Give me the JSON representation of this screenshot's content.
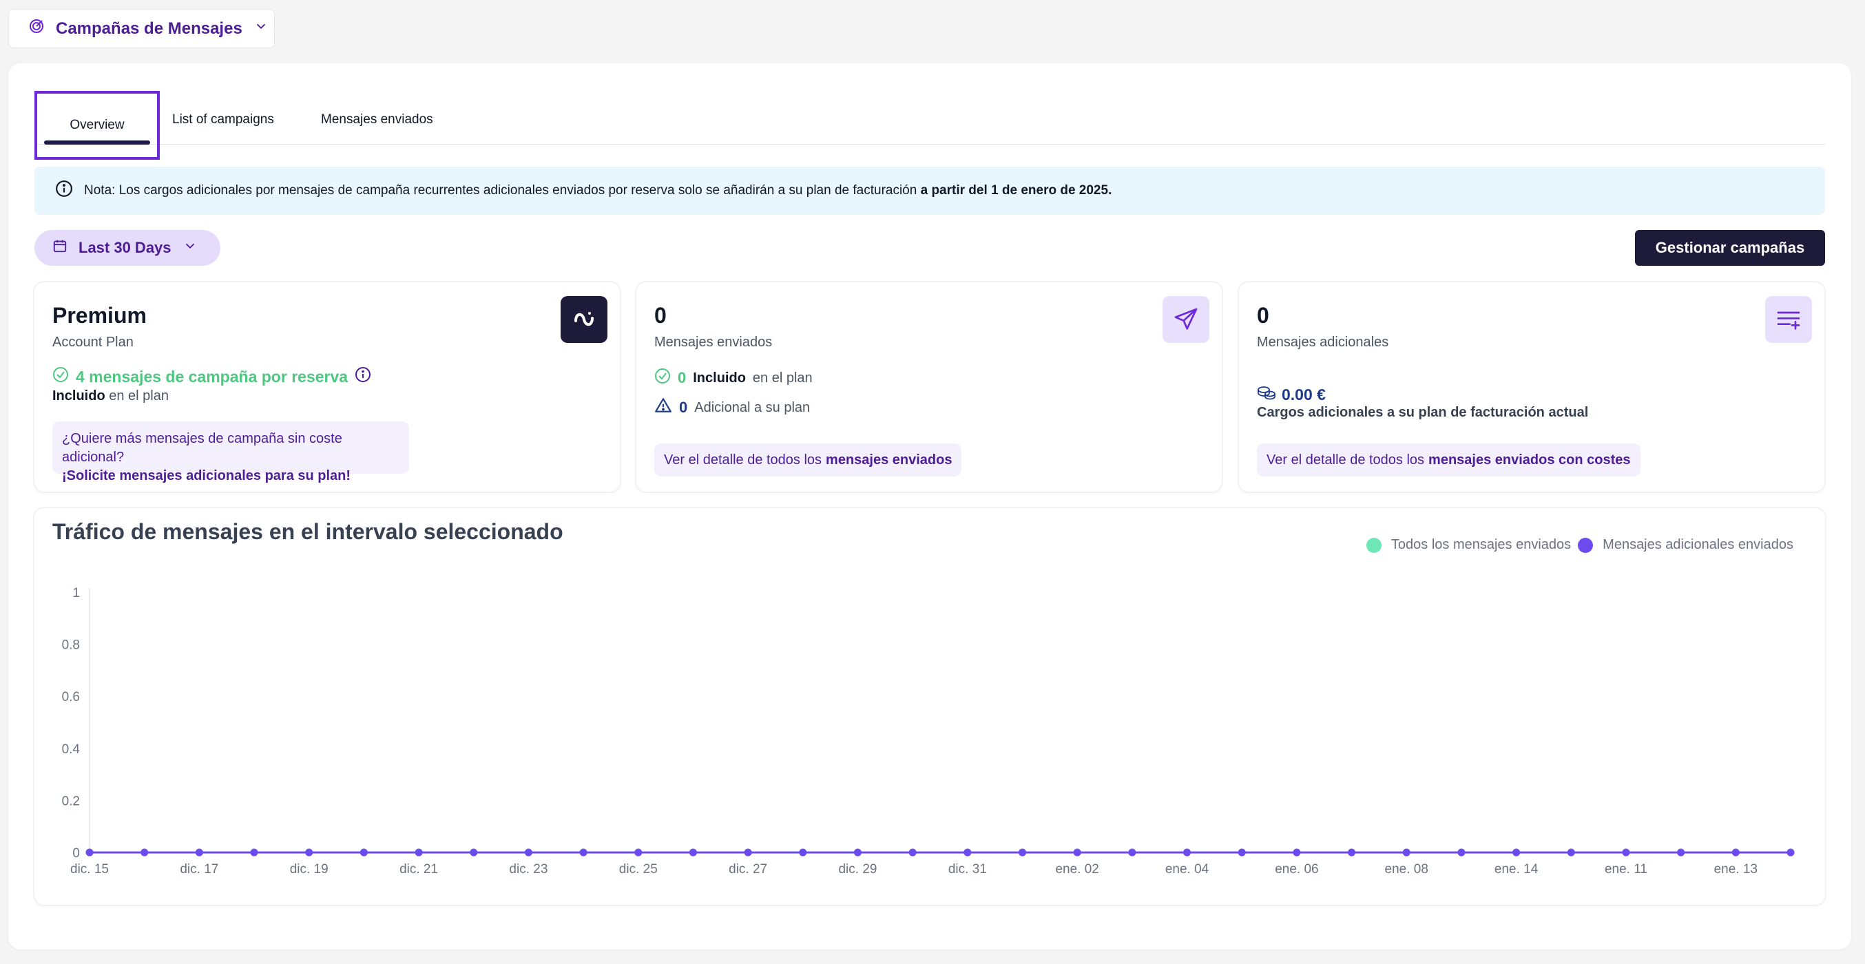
{
  "top_selector": {
    "label": "Campañas de Mensajes"
  },
  "tabs": [
    {
      "label": "Overview",
      "active": true
    },
    {
      "label": "List of campaigns",
      "active": false
    },
    {
      "label": "Mensajes enviados",
      "active": false
    }
  ],
  "note": {
    "text": "Nota: Los cargos adicionales por mensajes de campaña recurrentes adicionales enviados por reserva solo se añadirán a su plan de facturación ",
    "bold": "a partir del 1 de enero de 2025."
  },
  "date_filter": {
    "label": "Last 30 Days"
  },
  "manage_button": {
    "label": "Gestionar campañas"
  },
  "cards": {
    "plan": {
      "title": "Premium",
      "subtitle": "Account Plan",
      "campaign_msgs": "4 mensajes de campaña por reserva",
      "included_bold": "Incluido",
      "included_rest": " en el plan",
      "promo_line1": "¿Quiere más mensajes de campaña sin coste adicional?",
      "promo_line2": "¡Solicite mensajes adicionales para su plan!"
    },
    "sent": {
      "count": "0",
      "subtitle": "Mensajes enviados",
      "included_num": "0",
      "included_bold": "Incluido",
      "included_rest": "en el plan",
      "additional_num": "0",
      "additional_rest": "Adicional a su plan",
      "link_prefix": "Ver el detalle de todos los",
      "link_bold": "mensajes enviados"
    },
    "additional": {
      "count": "0",
      "subtitle": "Mensajes adicionales",
      "amount": "0.00 €",
      "charges": "Cargos adicionales a su plan de facturación actual",
      "link_prefix": "Ver el detalle de todos los",
      "link_bold": "mensajes enviados con costes"
    }
  },
  "chart": {
    "title": "Tráfico de mensajes en el intervalo seleccionado",
    "legend": [
      {
        "label": "Todos los mensajes enviados",
        "color": "#6ee7b7"
      },
      {
        "label": "Mensajes adicionales enviados",
        "color": "#6d4aed"
      }
    ]
  },
  "chart_data": {
    "type": "line",
    "title": "Tráfico de mensajes en el intervalo seleccionado",
    "xlabel": "",
    "ylabel": "",
    "ylim": [
      0,
      1
    ],
    "y_ticks": [
      "0",
      "0.2",
      "0.4",
      "0.6",
      "0.8",
      "1"
    ],
    "x_tick_labels": [
      "dic. 15",
      "dic. 17",
      "dic. 19",
      "dic. 21",
      "dic. 23",
      "dic. 25",
      "dic. 27",
      "dic. 29",
      "dic. 31",
      "ene. 02",
      "ene. 04",
      "ene. 06",
      "ene. 08",
      "ene. 14",
      "ene. 11",
      "ene. 13"
    ],
    "point_count": 32,
    "series": [
      {
        "name": "Todos los mensajes enviados",
        "color": "#6ee7b7",
        "values": [
          0,
          0,
          0,
          0,
          0,
          0,
          0,
          0,
          0,
          0,
          0,
          0,
          0,
          0,
          0,
          0,
          0,
          0,
          0,
          0,
          0,
          0,
          0,
          0,
          0,
          0,
          0,
          0,
          0,
          0,
          0,
          0
        ]
      },
      {
        "name": "Mensajes adicionales enviados",
        "color": "#6d4aed",
        "values": [
          0,
          0,
          0,
          0,
          0,
          0,
          0,
          0,
          0,
          0,
          0,
          0,
          0,
          0,
          0,
          0,
          0,
          0,
          0,
          0,
          0,
          0,
          0,
          0,
          0,
          0,
          0,
          0,
          0,
          0,
          0,
          0
        ]
      }
    ],
    "grid": false,
    "legend_position": "top-right"
  },
  "colors": {
    "accent": "#6d28d9",
    "dark": "#1e1b3a",
    "success": "#4ec781",
    "info_bg": "#e8f7fd"
  },
  "icons": {
    "top_selector": "target-icon",
    "note": "info-icon",
    "date_filter": "calendar-icon",
    "plan_card": "brand-logo-icon",
    "sent_card": "send-icon",
    "additional_card": "list-add-icon"
  }
}
